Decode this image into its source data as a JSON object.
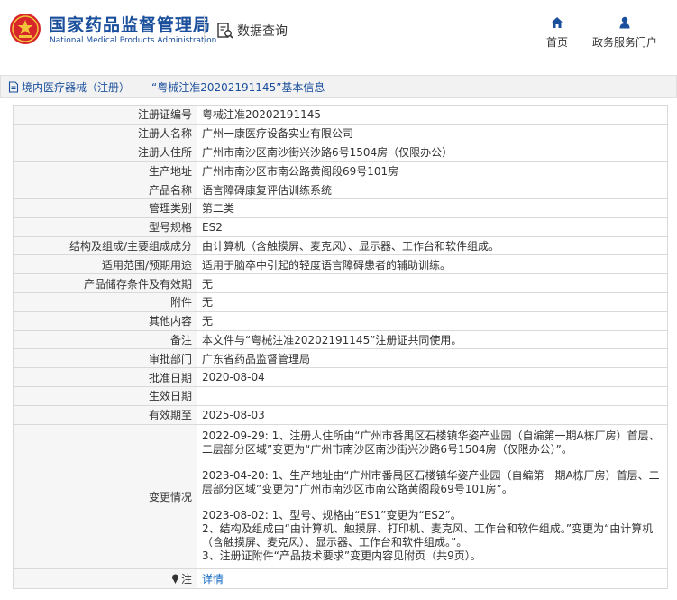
{
  "header": {
    "site_title_cn": "国家药品监督管理局",
    "site_title_en": "National Medical Products Administration",
    "data_query_label": "数据查询",
    "nav": [
      {
        "label": "首页",
        "icon": "home-icon"
      },
      {
        "label": "政务服务门户",
        "icon": "user-icon"
      }
    ]
  },
  "breadcrumb": {
    "text": "境内医疗器械（注册）——“粤械注准20202191145”基本信息",
    "icon": "document-icon"
  },
  "fields": [
    {
      "label": "注册证编号",
      "value": "粤械注准20202191145"
    },
    {
      "label": "注册人名称",
      "value": "广州一康医疗设备实业有限公司"
    },
    {
      "label": "注册人住所",
      "value": "广州市南沙区南沙街兴沙路6号1504房（仅限办公）"
    },
    {
      "label": "生产地址",
      "value": "广州市南沙区市南公路黄阁段69号101房"
    },
    {
      "label": "产品名称",
      "value": "语言障碍康复评估训练系统"
    },
    {
      "label": "管理类别",
      "value": "第二类"
    },
    {
      "label": "型号规格",
      "value": "ES2"
    },
    {
      "label": "结构及组成/主要组成成分",
      "value": "由计算机（含触摸屏、麦克风）、显示器、工作台和软件组成。"
    },
    {
      "label": "适用范围/预期用途",
      "value": "适用于脑卒中引起的轻度语言障碍患者的辅助训练。"
    },
    {
      "label": "产品储存条件及有效期",
      "value": "无"
    },
    {
      "label": "附件",
      "value": "无"
    },
    {
      "label": "其他内容",
      "value": "无"
    },
    {
      "label": "备注",
      "value": "本文件与“粤械注准20202191145”注册证共同使用。"
    },
    {
      "label": "审批部门",
      "value": "广东省药品监督管理局"
    },
    {
      "label": "批准日期",
      "value": "2020-08-04"
    },
    {
      "label": "生效日期",
      "value": ""
    },
    {
      "label": "有效期至",
      "value": "2025-08-03"
    }
  ],
  "changes": {
    "label": "变更情况",
    "entries": [
      "2022-09-29: 1、注册人住所由“广州市番禺区石楼镇华姿产业园（自编第一期A栋厂房）首层、二层部分区域”变更为“广州市南沙区南沙街兴沙路6号1504房（仅限办公）”。",
      "2023-04-20: 1、生产地址由“广州市番禺区石楼镇华姿产业园（自编第一期A栋厂房）首层、二层部分区域”变更为“广州市南沙区市南公路黄阁段69号101房”。",
      "2023-08-02: 1、型号、规格由“ES1”变更为“ES2”。\n2、结构及组成由“由计算机、触摸屏、打印机、麦克风、工作台和软件组成。”变更为“由计算机（含触摸屏、麦克风）、显示器、工作台和软件组成。”。\n3、注册证附件“产品技术要求”变更内容见附页（共9页）。"
    ]
  },
  "note": {
    "label": "注",
    "icon": "pin-icon",
    "link_text": "详情"
  },
  "colors": {
    "brand_blue": "#1a4f9c",
    "link_blue": "#1a6dc3",
    "emblem_red": "#d7262b",
    "emblem_gold": "#f3c33a"
  }
}
